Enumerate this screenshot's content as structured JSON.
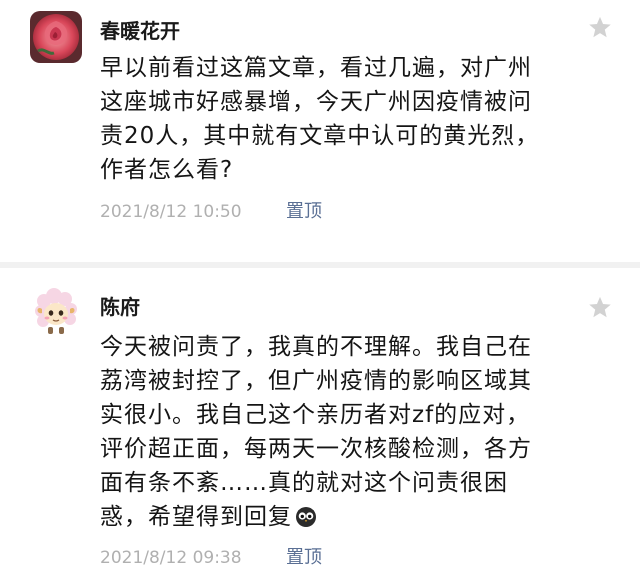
{
  "comments": [
    {
      "avatar": "rose-avatar",
      "name": "春暖花开",
      "lines": [
        "早以前看过这篇文章，看过几遍，对广州",
        "这座城市好感暴增，今天广州因疫情被问",
        "责20人，其中就有文章中认可的黄光烈，",
        "作者怎么看?"
      ],
      "timestamp": "2021/8/12 10:50",
      "pin_label": "置顶",
      "star_icon": "star-icon"
    },
    {
      "avatar": "sheep-avatar",
      "name": "陈府",
      "lines": [
        "今天被问责了，我真的不理解。我自己在",
        "荔湾被封控了，但广州疫情的影响区域其",
        "实很小。我自己这个亲历者对zf的应对，",
        "评价超正面，每两天一次核酸检测，各方",
        "面有条不紊……真的就对这个问责很困",
        "惑，希望得到回复"
      ],
      "emoji": "owl-emoji-icon",
      "timestamp": "2021/8/12 09:38",
      "pin_label": "置顶",
      "star_icon": "star-icon"
    }
  ],
  "colors": {
    "name": "#1a1a1a",
    "text": "#151515",
    "timestamp": "#b0b0b0",
    "pin_link": "#5a6f94",
    "star": "#d2d2d2",
    "divider": "#f1f1f1"
  }
}
